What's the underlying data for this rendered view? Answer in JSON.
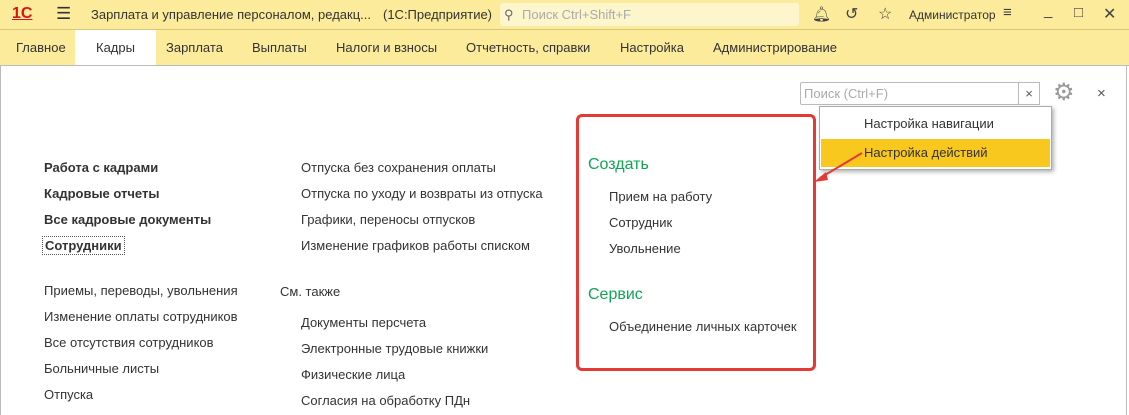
{
  "titlebar": {
    "logo": "1С",
    "title": "Зарплата и управление персоналом, редакц...",
    "platform": "(1С:Предприятие)",
    "search_placeholder": "Поиск Ctrl+Shift+F",
    "user": "Администратор"
  },
  "menu": [
    "Главное",
    "Кадры",
    "Зарплата",
    "Выплаты",
    "Налоги и взносы",
    "Отчетность, справки",
    "Настройка",
    "Администрирование"
  ],
  "search": {
    "placeholder": "Поиск (Ctrl+F)",
    "clear": "×"
  },
  "close_label": "×",
  "dropdown": [
    "Настройка навигации",
    "Настройка действий"
  ],
  "left_main": [
    "Работа с кадрами",
    "Кадровые отчеты",
    "Все кадровые документы",
    "Сотрудники"
  ],
  "left_more": [
    "Приемы, переводы, увольнения",
    "Изменение оплаты сотрудников",
    "Все отсутствия сотрудников",
    "Больничные листы",
    "Отпуска"
  ],
  "mid_main": [
    "Отпуска без сохранения оплаты",
    "Отпуска по уходу и возвраты из отпуска",
    "Графики, переносы отпусков",
    "Изменение графиков работы списком"
  ],
  "see_also": {
    "title": "См. также",
    "items": [
      "Документы персчета",
      "Электронные трудовые книжки",
      "Физические лица",
      "Согласия на обработку ПДн"
    ]
  },
  "actions": {
    "create_title": "Создать",
    "create": [
      "Прием на работу",
      "Сотрудник",
      "Увольнение"
    ],
    "service_title": "Сервис",
    "service": [
      "Объединение личных карточек"
    ]
  },
  "colors": {
    "accent": "#fbeb9b",
    "highlight": "#f8c81e",
    "green": "#0fa456",
    "annotation": "#e53935"
  }
}
